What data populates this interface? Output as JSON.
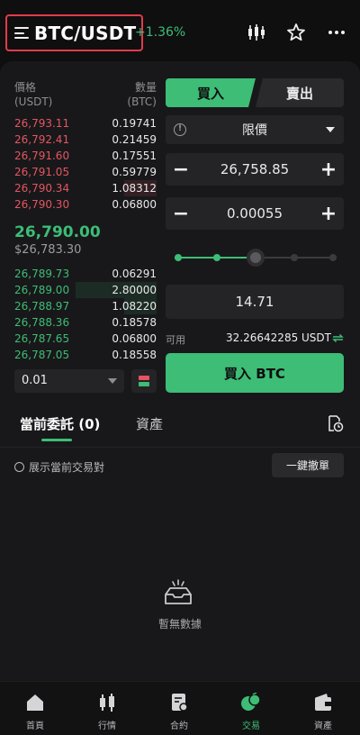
{
  "header": {
    "pair": "BTC/USDT",
    "change": "+1.36%",
    "icons": [
      "menu-icon",
      "candlestick-icon",
      "star-icon",
      "more-icon"
    ]
  },
  "orderbook": {
    "price_header": "價格",
    "price_unit": "(USDT)",
    "qty_header": "數量",
    "qty_unit": "(BTC)",
    "asks": [
      {
        "price": "26,793.11",
        "qty": "0.19741",
        "depth": 0.0
      },
      {
        "price": "26,792.41",
        "qty": "0.21459",
        "depth": 0.0
      },
      {
        "price": "26,791.60",
        "qty": "0.17551",
        "depth": 0.0
      },
      {
        "price": "26,791.05",
        "qty": "0.59779",
        "depth": 0.0
      },
      {
        "price": "26,790.34",
        "qty": "1.08312",
        "depth": 0.38
      },
      {
        "price": "26,790.30",
        "qty": "0.06800",
        "depth": 0.0
      }
    ],
    "last_price": "26,790.00",
    "last_price_usd": "$26,783.30",
    "bids": [
      {
        "price": "26,789.73",
        "qty": "0.06291",
        "depth": 0.0
      },
      {
        "price": "26,789.00",
        "qty": "2.80000",
        "depth": 0.95
      },
      {
        "price": "26,788.97",
        "qty": "1.08220",
        "depth": 0.38
      },
      {
        "price": "26,788.36",
        "qty": "0.18578",
        "depth": 0.0
      },
      {
        "price": "26,787.65",
        "qty": "0.06800",
        "depth": 0.0
      },
      {
        "price": "26,787.05",
        "qty": "0.18558",
        "depth": 0.0
      }
    ],
    "precision": "0.01"
  },
  "trade": {
    "buy_tab": "買入",
    "sell_tab": "賣出",
    "order_type": "限價",
    "price": "26,758.85",
    "amount": "0.00055",
    "slider_percent": 50,
    "total": "14.71",
    "available_label": "可用",
    "available_value": "32.26642285 USDT",
    "buy_button": "買入 BTC",
    "colors": {
      "buy": "#3dbd76",
      "sell": "#e55561"
    }
  },
  "orders": {
    "tab_open": "當前委託 (0)",
    "tab_assets": "資產",
    "show_current_pair": "展示當前交易對",
    "cancel_all": "一鍵撤單",
    "empty_text": "暫無數據"
  },
  "nav": {
    "items": [
      {
        "label": "首頁",
        "icon": "home-icon"
      },
      {
        "label": "行情",
        "icon": "market-icon"
      },
      {
        "label": "合約",
        "icon": "contract-icon"
      },
      {
        "label": "交易",
        "icon": "trade-icon",
        "active": true
      },
      {
        "label": "資產",
        "icon": "wallet-icon"
      }
    ]
  }
}
